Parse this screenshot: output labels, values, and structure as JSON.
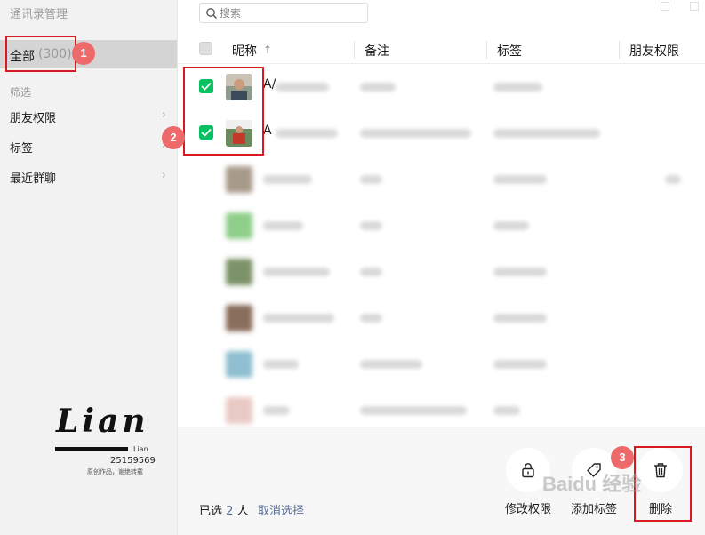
{
  "app": {
    "title": "通讯录管理"
  },
  "sidebar": {
    "all_label": "全部",
    "all_count": "(300)",
    "filter_heading": "筛选",
    "items": [
      {
        "label": "朋友权限"
      },
      {
        "label": "标签"
      },
      {
        "label": "最近群聊"
      }
    ]
  },
  "search": {
    "placeholder": "搜索"
  },
  "table": {
    "columns": [
      "昵称",
      "备注",
      "标签",
      "朋友权限"
    ],
    "sort_indicator": "↑",
    "rows": [
      {
        "selected": true,
        "nickname": "A/"
      },
      {
        "selected": true,
        "nickname": "A"
      }
    ]
  },
  "footer": {
    "selected_prefix": "已选",
    "selected_count": "2",
    "selected_suffix": "人",
    "cancel_selection": "取消选择",
    "actions": [
      {
        "label": "修改权限",
        "icon": "lock-icon"
      },
      {
        "label": "添加标签",
        "icon": "tag-icon"
      },
      {
        "label": "删除",
        "icon": "trash-icon"
      }
    ]
  },
  "annotations": {
    "badges": [
      "1",
      "2",
      "3"
    ]
  },
  "watermark": {
    "logo_text": "Lian",
    "logo_sub": "Lian",
    "number": "25159569",
    "caption": "原创作品，谢绝转载",
    "baidu": "Baidu 经验"
  },
  "colors": {
    "accent_green": "#07c160",
    "link_blue": "#576b95",
    "annotation_red": "#d71920",
    "badge_red": "#ee6a6a"
  }
}
